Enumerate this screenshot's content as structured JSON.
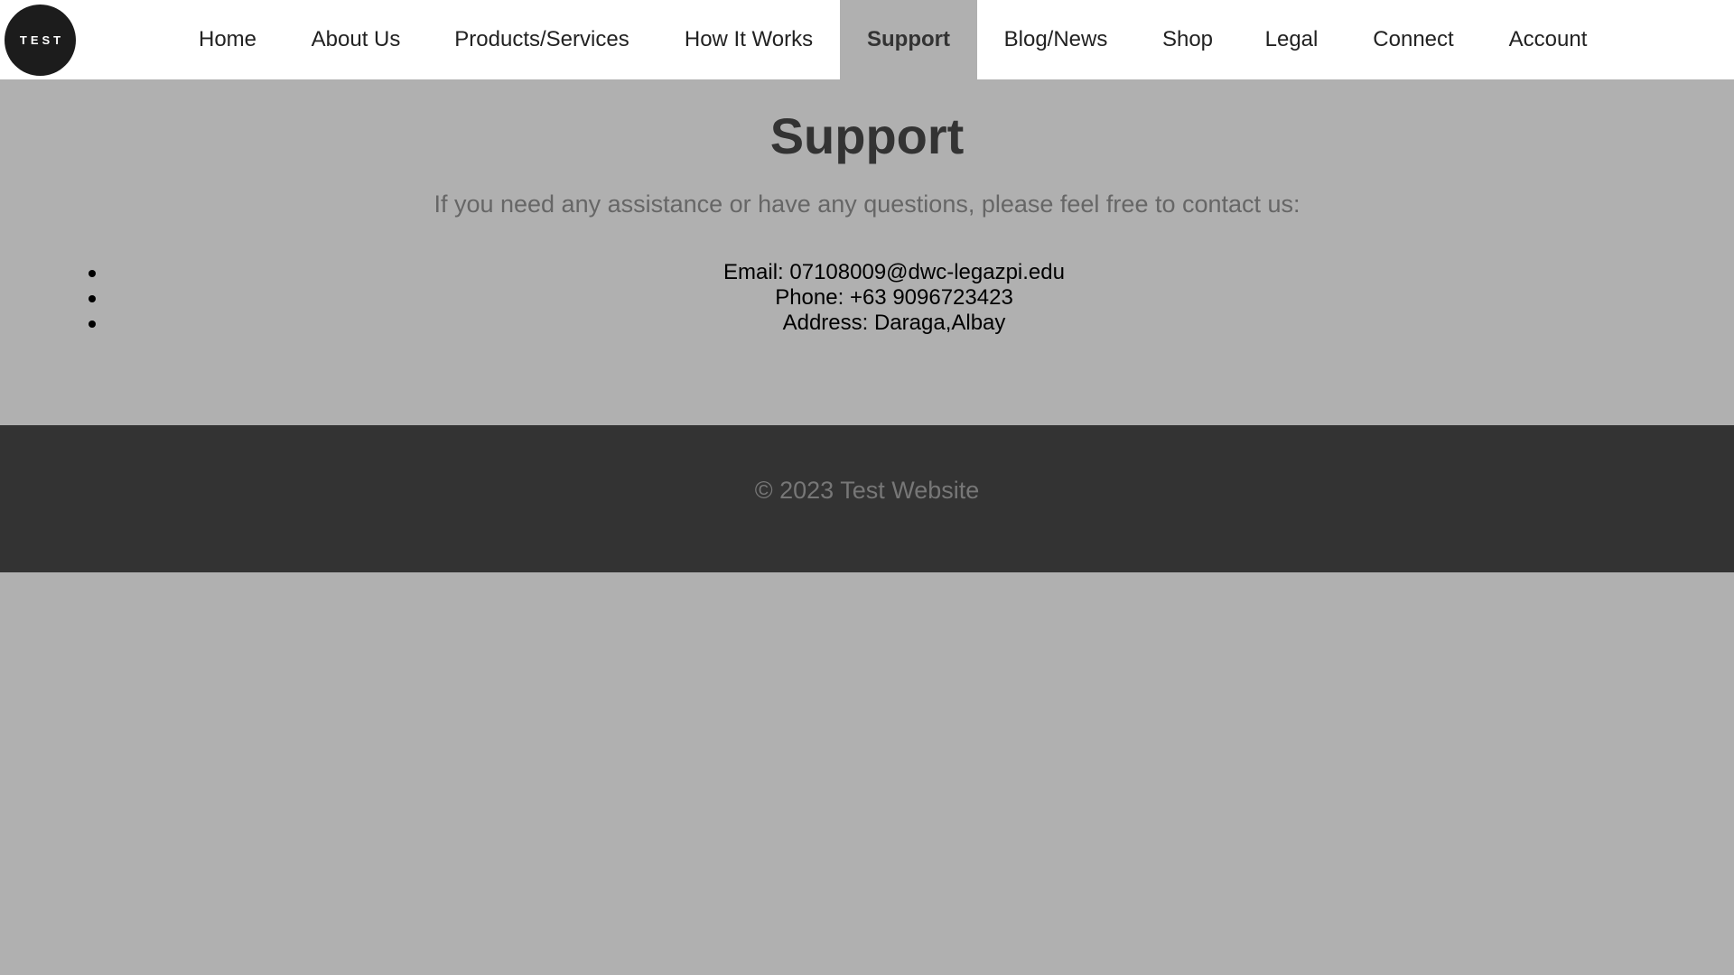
{
  "logo": {
    "text": "TEST"
  },
  "nav": {
    "items": [
      {
        "label": "Home"
      },
      {
        "label": "About Us"
      },
      {
        "label": "Products/Services"
      },
      {
        "label": "How It Works"
      },
      {
        "label": "Support"
      },
      {
        "label": "Blog/News"
      },
      {
        "label": "Shop"
      },
      {
        "label": "Legal"
      },
      {
        "label": "Connect"
      },
      {
        "label": "Account"
      }
    ],
    "active": "Support"
  },
  "main": {
    "title": "Support",
    "intro": "If you need any assistance or have any questions, please feel free to contact us:",
    "contacts": [
      "Email: 07108009@dwc-legazpi.edu",
      "Phone: +63 9096723423",
      "Address: Daraga,Albay"
    ]
  },
  "footer": {
    "copyright": "© 2023 Test Website"
  },
  "colors": {
    "page_background": "#b0b0b0",
    "header_background": "#ffffff",
    "footer_background": "#333333",
    "logo_background": "#1c1c1c"
  }
}
